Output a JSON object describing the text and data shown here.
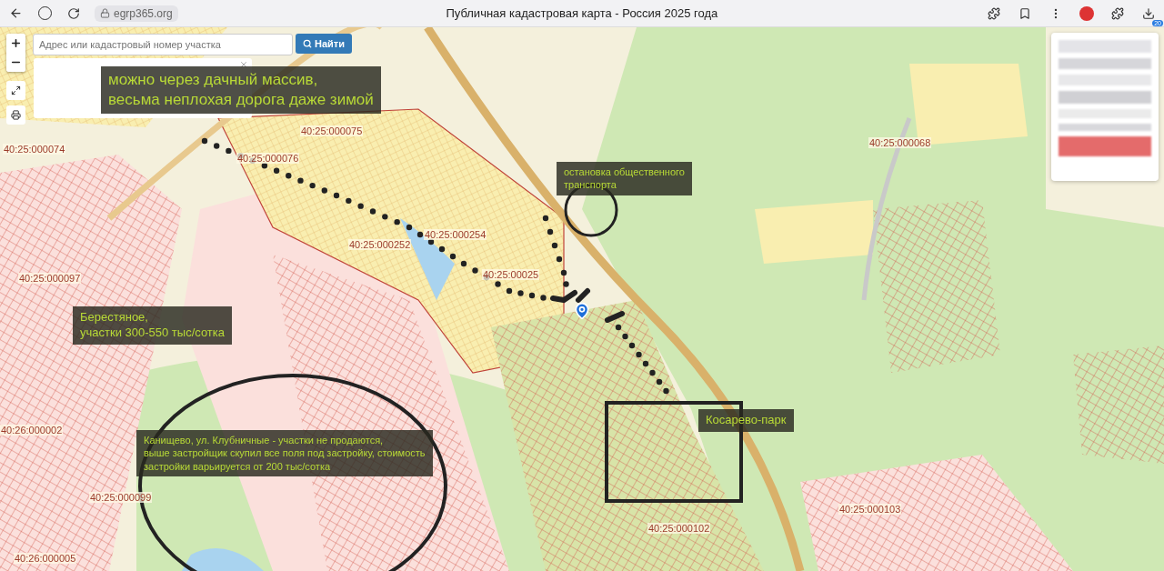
{
  "browser": {
    "url": "egrp365.org",
    "title": "Публичная кадастровая карта - Россия 2025 года",
    "downloads_badge": "20"
  },
  "search": {
    "placeholder": "Адрес или кадастровый номер участка",
    "button": "Найти"
  },
  "cadastral_labels": [
    {
      "text": "40:25:000074"
    },
    {
      "text": "40:25:000075"
    },
    {
      "text": "40:25:000076"
    },
    {
      "text": "40:25:000252"
    },
    {
      "text": "40:25:000254"
    },
    {
      "text": "40:25:00025"
    },
    {
      "text": "40:25:000068"
    },
    {
      "text": "40:25:000097"
    },
    {
      "text": "40:26:000002"
    },
    {
      "text": "40:25:000099"
    },
    {
      "text": "40:26:000005"
    },
    {
      "text": "40:25:000102"
    },
    {
      "text": "40:25:000103"
    }
  ],
  "annotations": [
    {
      "kind": "large",
      "lines": [
        "можно через дачный массив,",
        "весьма неплохая дорога даже зимой"
      ]
    },
    {
      "kind": "small",
      "lines": [
        "остановка общественного",
        "транспорта"
      ]
    },
    {
      "kind": "medium",
      "lines": [
        "Берестяное,",
        "участки 300-550 тыс/сотка"
      ]
    },
    {
      "kind": "small",
      "lines": [
        "Канищево, ул. Клубничные - участки не продаются,",
        "выше застройщик скупил все поля под застройку, стоимость",
        "застройки варьируется от 200 тыс/сотка"
      ]
    },
    {
      "kind": "medium",
      "lines": [
        "Косарево-парк"
      ]
    }
  ]
}
